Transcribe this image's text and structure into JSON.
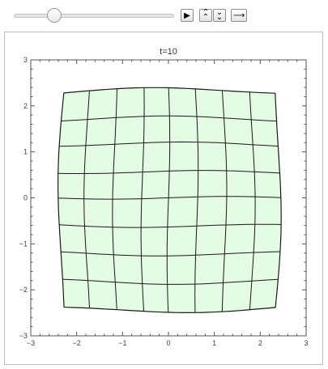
{
  "controls": {
    "slider_value": 10,
    "slider_min": 0,
    "slider_max": 40,
    "buttons": [
      {
        "name": "play-button",
        "icon": "play-icon",
        "glyph": "▶"
      },
      {
        "name": "faster-button",
        "icon": "double-chevron-up-icon",
        "glyph": "⌃"
      },
      {
        "name": "slower-button",
        "icon": "double-chevron-down-icon",
        "glyph": "⌄"
      },
      {
        "name": "direction-button",
        "icon": "arrow-right-icon",
        "glyph": "⟶"
      }
    ]
  },
  "chart_data": {
    "type": "grid-deformation",
    "title": "t=10",
    "xlabel": "",
    "ylabel": "",
    "xlim": [
      -3,
      3
    ],
    "ylim": [
      -3,
      3
    ],
    "xticks": [
      -3,
      -2,
      -1,
      0,
      1,
      2,
      3
    ],
    "yticks": [
      -3,
      -2,
      -1,
      0,
      1,
      2,
      3
    ],
    "tick_labels_x": [
      "−3",
      "−2",
      "−1",
      "0",
      "1",
      "2",
      "3"
    ],
    "tick_labels_y": [
      "−3",
      "−2",
      "−1",
      "0",
      "1",
      "2",
      "3"
    ],
    "fill_color": "#e3fce3",
    "line_color": "#1a1a1a",
    "grid_x": [
      -2.3,
      -1.75,
      -1.15,
      -0.55,
      0.0,
      0.6,
      1.2,
      1.8,
      2.35
    ],
    "grid_y": [
      2.3,
      1.7,
      1.15,
      0.55,
      0.0,
      -0.6,
      -1.2,
      -1.8,
      -2.4
    ],
    "corners": {
      "top_left": [
        -2.3,
        2.3
      ],
      "top_right": [
        2.35,
        2.35
      ],
      "bottom_left": [
        -2.35,
        -2.3
      ],
      "bottom_right": [
        2.35,
        -2.3
      ],
      "top_mid_y": 2.4,
      "bottom_mid_y": -2.4,
      "left_mid_x": -2.4,
      "right_mid_x": 2.45
    }
  }
}
